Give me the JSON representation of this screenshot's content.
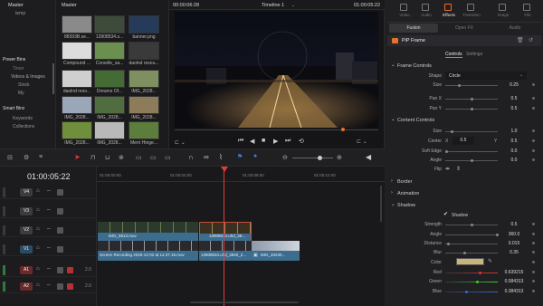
{
  "media_pool": {
    "header": "Master",
    "tree": {
      "master": "Master",
      "temp": "temp",
      "power_bins": "Power Bins",
      "timer": "Timer",
      "videos_images": "Videos & Images",
      "stock": "Stock",
      "my": "My",
      "smart_bins": "Smart Bins",
      "keywords": "Keywords",
      "collections": "Collections"
    },
    "thumbs": [
      {
        "label": "88393B.xe...",
        "color": "#8a8a8a"
      },
      {
        "label": "13908534.s...",
        "color": "#3f4b3a"
      },
      {
        "label": "Compound ...",
        "color": "#dcdcdc"
      },
      {
        "label": "Corselle_sa...",
        "color": "#6b8f4e"
      },
      {
        "label": "daolnd resou...",
        "color": "#3a3a3a"
      },
      {
        "label": "daolnd reso...",
        "color": "#cfcfcf"
      },
      {
        "label": "IMG_2028...",
        "color": "#7f8f60"
      },
      {
        "label": "IMG_2028...",
        "color": "#9aa7b8"
      },
      {
        "label": "IMG_2028...",
        "color": "#4f6d3e"
      },
      {
        "label": "IMG_2028...",
        "color": "#8d7c59"
      },
      {
        "label": "IMG_2028...",
        "color": "#6f8f3c"
      },
      {
        "label": "IMG_2028...",
        "color": "#b9b9b9"
      },
      {
        "label": "Dreams Of...",
        "color": "#456b34"
      },
      {
        "label": "Merri Hinge...",
        "color": "#5d7d3c"
      },
      {
        "label": "banner.png",
        "color": "#263b5a"
      }
    ]
  },
  "viewer": {
    "timecode_left": "00:00:06:28",
    "timeline_name": "Timeline 1",
    "timecode_right": "01:00:05:22"
  },
  "timeline": {
    "current_tc": "01:00:05:22",
    "ruler": [
      "01:00:00:00",
      "01:00:04:00",
      "01:00:08:00",
      "01:00:12:00"
    ],
    "tracks": [
      {
        "id": "V4",
        "type": "video"
      },
      {
        "id": "V3",
        "type": "video"
      },
      {
        "id": "V2",
        "type": "video"
      },
      {
        "id": "V1",
        "type": "video"
      },
      {
        "id": "A1",
        "type": "audio",
        "level": "2.0"
      },
      {
        "id": "A2",
        "type": "audio",
        "level": "2.0"
      }
    ],
    "clips": {
      "v2_a": "IMG_5813.mov",
      "v2_b": "13908534.uhd_38...",
      "v1_a": "Screen Recording 2025-12-02 at 12.37.15.mov",
      "v1_b": "13908534.uhd_3840_2...",
      "v1_c": "IMG_20230..."
    }
  },
  "inspector": {
    "top_tabs": [
      "Video",
      "Audio",
      "Effects",
      "Transition",
      "Image",
      "File"
    ],
    "sub_tabs": [
      "Fusion",
      "Open FX",
      "Audio"
    ],
    "effect_title": "PiP Frame",
    "controls_tabs": [
      "Controls",
      "Settings"
    ],
    "frame_controls": {
      "title": "Frame Controls",
      "shape_label": "Shape",
      "shape_value": "Circle",
      "size_label": "Size",
      "size_value": "0.25",
      "panx_label": "Pan X",
      "panx_value": "0.5",
      "pany_label": "Pan Y",
      "pany_value": "0.5"
    },
    "content_controls": {
      "title": "Content Controls",
      "size_label": "Size",
      "size_value": "1.0",
      "center_label": "Center",
      "center_x_label": "X",
      "center_x": "0.5",
      "center_y_label": "Y",
      "center_y": "0.5",
      "soft_edge_label": "Soft Edge",
      "soft_edge_value": "0.0",
      "angle_label": "Angle",
      "angle_value": "0.0",
      "flip_label": "Flip"
    },
    "sections": {
      "border": "Border",
      "animation": "Animation",
      "shadow": "Shadow"
    },
    "shadow": {
      "toggle_label": "Shadow",
      "strength_label": "Strength",
      "strength_value": "0.5",
      "angle_label": "Angle",
      "angle_value": "360.0",
      "distance_label": "Distance",
      "distance_value": "0.015",
      "blur_label": "Blur",
      "blur_value": "0.35",
      "color_label": "Color",
      "color_hex": "#c8b47d",
      "red_label": "Red",
      "red_value": "0.639215",
      "green_label": "Green",
      "green_value": "0.584313",
      "blue_label": "Blue",
      "blue_value": "0.384313"
    }
  },
  "colors": {
    "accent": "#e8702a",
    "playhead": "#e23b3b",
    "clip_blue": "#3c6d8f",
    "clip_selected": "#c44e3a"
  }
}
